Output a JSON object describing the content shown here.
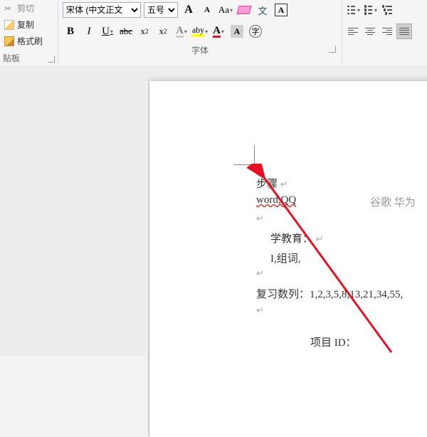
{
  "clipboard": {
    "cut_label": "剪切",
    "copy_label": "复制",
    "format_painter_label": "格式刷",
    "section_label": "贴板"
  },
  "font": {
    "name_value": "宋体 (中文正文",
    "size_value": "五号",
    "grow": "A",
    "shrink": "A",
    "case": "Aa",
    "clear": "⌫",
    "phonetic": "文",
    "border": "A",
    "bold": "B",
    "italic": "I",
    "underline": "U",
    "strike": "abc",
    "sub_x": "x",
    "sub_2": "2",
    "sup_x": "x",
    "sup_2": "2",
    "color_a": "A",
    "highlight": "aby",
    "red_a": "A",
    "shade_a": "A",
    "circled": "字",
    "section_label": "字体"
  },
  "document": {
    "line1": "步骤",
    "line2": "word,QQ",
    "line2_right": "谷歌 华为",
    "line3a": "学教育：",
    "line3b": "I,组词,",
    "line4_label": "复习数列：",
    "line4_values": "1,2,3,5,8,13,21,34,55,",
    "line5": "项目 ID："
  },
  "arrow": {
    "color": "#e81123"
  }
}
